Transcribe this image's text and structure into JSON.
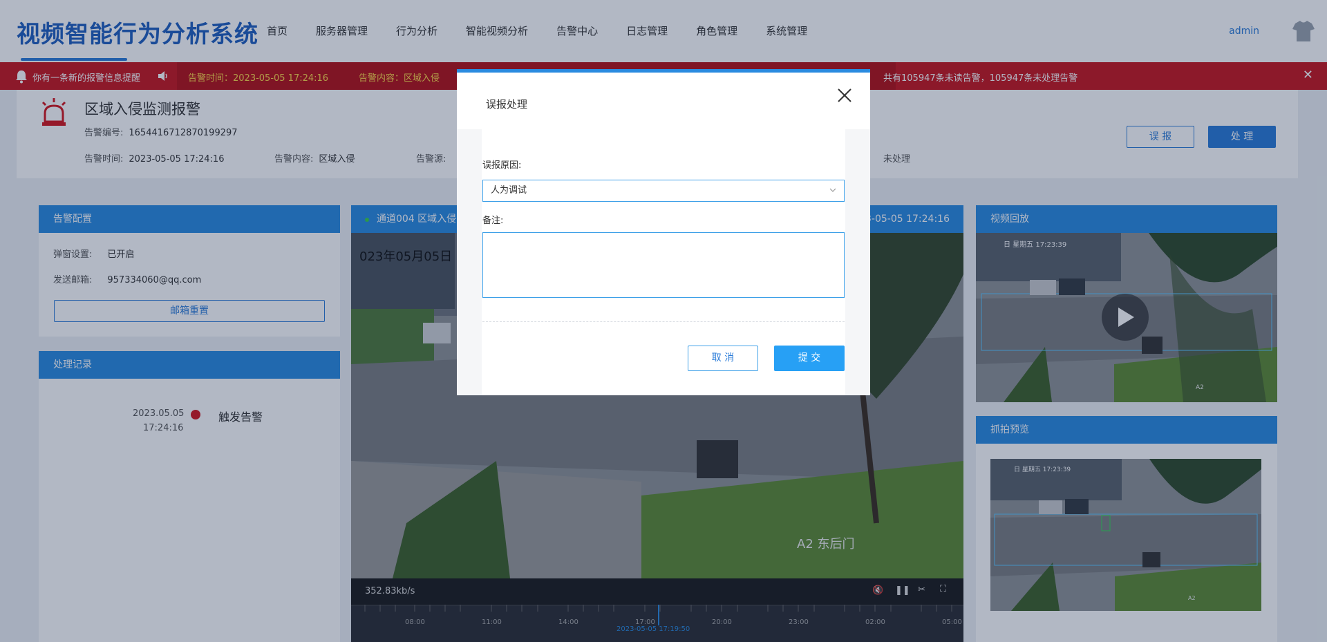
{
  "app": {
    "title": "视频智能行为分析系统",
    "nav": [
      "首页",
      "服务器管理",
      "行为分析",
      "智能视频分析",
      "告警中心",
      "日志管理",
      "角色管理",
      "系统管理"
    ],
    "user": "admin",
    "brand_color": "#2a7bd8"
  },
  "banner": {
    "message": "你有一条新的报警信息提醒",
    "ticker_time": "告警时间：2023-05-05 17:24:16",
    "ticker_content": "告警内容：区域入侵",
    "count_text": "共有105947条未读告警，105947条未处理告警",
    "color": "#c8161d"
  },
  "alarm": {
    "title": "区域入侵监测报警",
    "id_label": "告警编号:",
    "id_value": "1654416712870199297",
    "time_label": "告警时间:",
    "time_value": "2023-05-05 17:24:16",
    "content_label": "告警内容:",
    "content_value": "区域入侵",
    "source_label": "告警源:",
    "status_partial": "未处理",
    "false_button": "误 报",
    "handle_button": "处 理"
  },
  "config_panel": {
    "title": "告警配置",
    "popup_label": "弹窗设置:",
    "popup_value": "已开启",
    "email_label": "发送邮箱:",
    "email_value": "957334060@qq.com",
    "reset_button": "邮箱重置"
  },
  "record_panel": {
    "title": "处理记录",
    "entries": [
      {
        "date": "2023.05.05",
        "time": "17:24:16",
        "event": "触发告警"
      }
    ]
  },
  "video": {
    "channel": "通道004 区域入侵",
    "timestamp": "2023-05-05 17:24:16",
    "overlay_date": "023年05月05日",
    "cam_label": "A2 东后门",
    "bitrate": "352.83kb/s",
    "timeline_ticks": [
      "08:00",
      "11:00",
      "14:00",
      "17:00",
      "20:00",
      "23:00",
      "02:00",
      "05:00"
    ],
    "cursor_time": "2023-05-05 17:19:50"
  },
  "playback_panel": {
    "title": "视频回放"
  },
  "snapshot_panel": {
    "title": "抓拍预览"
  },
  "thumb_overlay": {
    "text": "日 星期五 17:23:39",
    "cam": "A2"
  },
  "modal": {
    "title": "误报处理",
    "reason_label": "误报原因:",
    "reason_value": "人为调试",
    "note_label": "备注:",
    "note_value": "",
    "cancel": "取 消",
    "submit": "提 交"
  }
}
